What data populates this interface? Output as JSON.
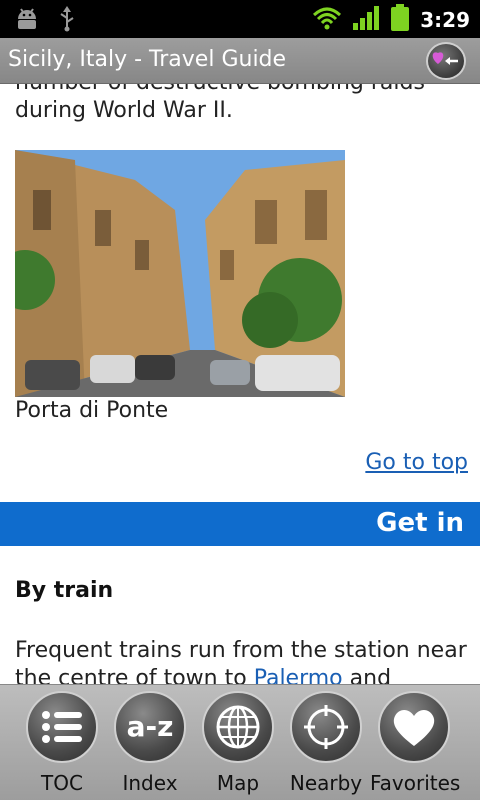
{
  "status_bar": {
    "time": "3:29",
    "icons": [
      "android-debug-icon",
      "usb-icon",
      "wifi-icon",
      "signal-icon",
      "battery-icon"
    ]
  },
  "title_bar": {
    "title": "Sicily, Italy - Travel Guide",
    "favorite_back_icon": "heart-back-icon"
  },
  "article": {
    "intro_line1": "number of destructive bombing raids",
    "intro_line2": "during World War II.",
    "image_caption": "Porta di Ponte",
    "go_to_top": "Go to top",
    "section_title": "Get in",
    "subheading": "By train",
    "body_line1": "Frequent trains run from the station near",
    "body_line2_prefix": "the centre of town to ",
    "body_line2_link": "Palermo",
    "body_line2_suffix": " and"
  },
  "toolbar": {
    "items": [
      {
        "label": "TOC",
        "icon": "list-icon"
      },
      {
        "label": "Index",
        "icon": "a-z-icon"
      },
      {
        "label": "Map",
        "icon": "globe-icon"
      },
      {
        "label": "Nearby",
        "icon": "crosshair-icon"
      },
      {
        "label": "Favorites",
        "icon": "heart-icon"
      }
    ]
  },
  "colors": {
    "section_bar": "#0f6ccd",
    "link": "#1a5fb4",
    "title_bar": "#909090"
  }
}
